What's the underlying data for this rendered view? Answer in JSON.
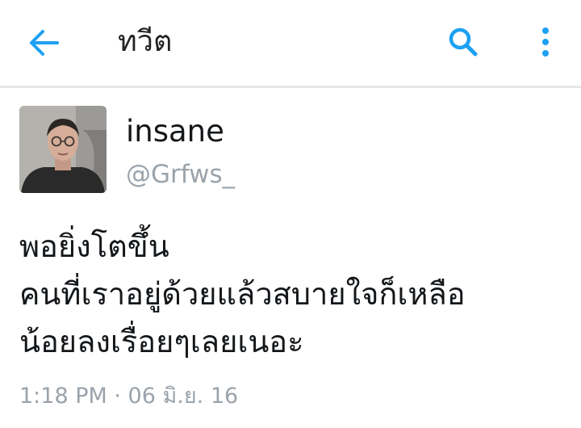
{
  "header": {
    "title": "ทวีต",
    "back_icon": "arrow-left-icon",
    "search_icon": "search-icon",
    "more_icon": "more-vertical-icon",
    "accent_color": "#1da1f2"
  },
  "tweet": {
    "display_name": "insane",
    "handle": "@Grfws_",
    "avatar_icon": "user-avatar",
    "text_lines": [
      "พอยิ่งโตขึ้น",
      "คนที่เราอยู่ด้วยแล้วสบายใจก็เหลือ",
      "น้อยลงเรื่อยๆเลยเนอะ"
    ],
    "timestamp": "1:18 PM · 06 มิ.ย. 16"
  }
}
